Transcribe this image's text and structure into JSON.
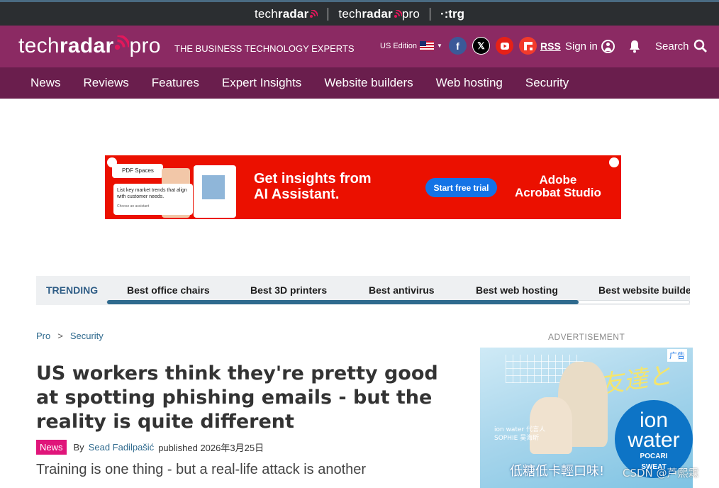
{
  "network_bar": {
    "brand1_a": "tech",
    "brand1_b": "radar",
    "brand2_a": "tech",
    "brand2_b": "radar",
    "brand2_c": "pro",
    "brand3": "trg"
  },
  "header": {
    "logo_a": "tech",
    "logo_b": "radar",
    "logo_c": "pro",
    "tagline": "THE BUSINESS TECHNOLOGY EXPERTS",
    "edition": "US Edition",
    "rss": "RSS",
    "sign_in": "Sign in",
    "search": "Search",
    "colors": {
      "header_bg": "#8b2a63",
      "nav_bg": "#6a1e4d",
      "network_bg": "#2b2e31"
    }
  },
  "nav": {
    "items": [
      "News",
      "Reviews",
      "Features",
      "Expert Insights",
      "Website builders",
      "Web hosting",
      "Security"
    ]
  },
  "ad_banner": {
    "mock_title": "PDF Spaces",
    "mock_text": "List key market trends that align with customer needs.",
    "mock_sub": "Choose an assistant",
    "headline_line1": "Get insights from",
    "headline_line2": "AI Assistant.",
    "cta": "Start free trial",
    "brand_line1": "Adobe",
    "brand_line2": "Acrobat Studio"
  },
  "trending": {
    "label": "TRENDING",
    "items": [
      "Best office chairs",
      "Best 3D printers",
      "Best antivirus",
      "Best web hosting",
      "Best website builde"
    ],
    "scroll_fraction": 0.81
  },
  "breadcrumb": {
    "items": [
      "Pro",
      "Security"
    ],
    "separator": ">"
  },
  "article": {
    "title": "US workers think they're pretty good at spotting phishing emails - but the reality is quite different",
    "tag": "News",
    "by": "By",
    "author": "Sead Fadilpašić",
    "published": "published 2026年3月25日",
    "standfirst": "Training is one thing - but a real-life attack is another"
  },
  "side_ad": {
    "label": "ADVERTISEMENT",
    "ad_tag": "广告",
    "jp_text": "友達と",
    "brand_ion": "ion",
    "brand_water": "water",
    "brand_pocari": "POCARI",
    "brand_sweat": "SWEAT",
    "small_line1": "ion water 代言人",
    "small_line2": "SOPHIE 吴海昕",
    "bottom_text": "低糖低卡輕口味!"
  },
  "watermark": "CSDN @芦熙霖"
}
